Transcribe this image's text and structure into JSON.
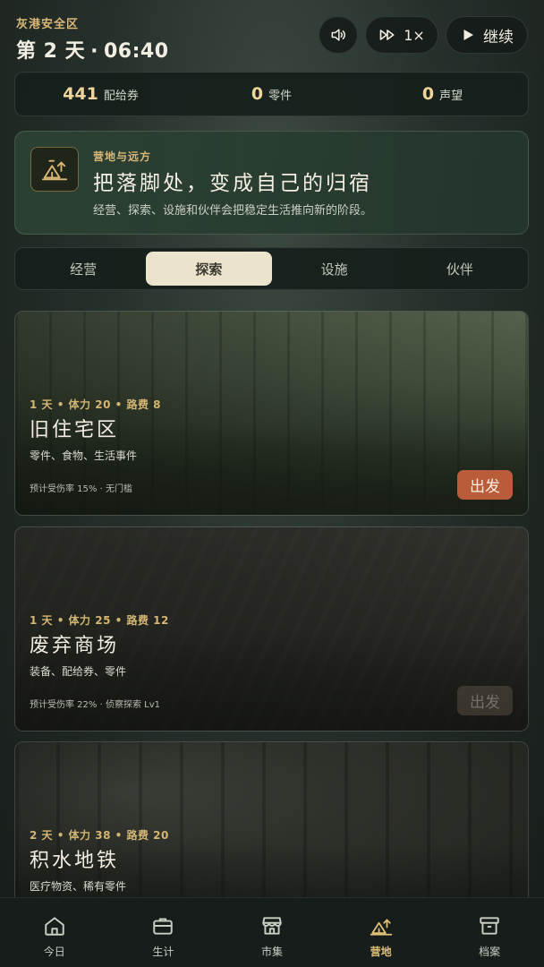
{
  "header": {
    "location": "灰港安全区",
    "day": "第 2 天",
    "separator": "·",
    "time": "06:40",
    "speed_label": "1×",
    "continue_label": "继续"
  },
  "resources": [
    {
      "value": "441",
      "label": "配给券"
    },
    {
      "value": "0",
      "label": "零件"
    },
    {
      "value": "0",
      "label": "声望"
    }
  ],
  "banner": {
    "icon": "camp-icon",
    "eyebrow": "营地与远方",
    "title": "把落脚处，变成自己的归宿",
    "description": "经营、探索、设施和伙伴会把稳定生活推向新的阶段。"
  },
  "tabs": [
    {
      "label": "经营",
      "active": false
    },
    {
      "label": "探索",
      "active": true
    },
    {
      "label": "设施",
      "active": false
    },
    {
      "label": "伙伴",
      "active": false
    }
  ],
  "destinations": [
    {
      "meta": "1 天 • 体力 20 • 路费 8",
      "name": "旧住宅区",
      "loot": "零件、食物、生活事件",
      "risk": "预计受伤率 15% · 无门槛",
      "action": "出发",
      "enabled": true
    },
    {
      "meta": "1 天 • 体力 25 • 路费 12",
      "name": "废弃商场",
      "loot": "装备、配给券、零件",
      "risk": "预计受伤率 22% · 侦察探索 Lv1",
      "action": "出发",
      "enabled": false
    },
    {
      "meta": "2 天 • 体力 38 • 路费 20",
      "name": "积水地铁",
      "loot": "医疗物资、稀有零件"
    }
  ],
  "nav": [
    {
      "label": "今日",
      "icon": "home-icon",
      "active": false
    },
    {
      "label": "生计",
      "icon": "briefcase-icon",
      "active": false
    },
    {
      "label": "市集",
      "icon": "storefront-icon",
      "active": false
    },
    {
      "label": "营地",
      "icon": "camp-icon",
      "active": true
    },
    {
      "label": "档案",
      "icon": "archive-icon",
      "active": false
    }
  ],
  "colors": {
    "accent": "#d9b877",
    "go_button": "#b85c3a",
    "active_tab": "#ece3cc"
  }
}
